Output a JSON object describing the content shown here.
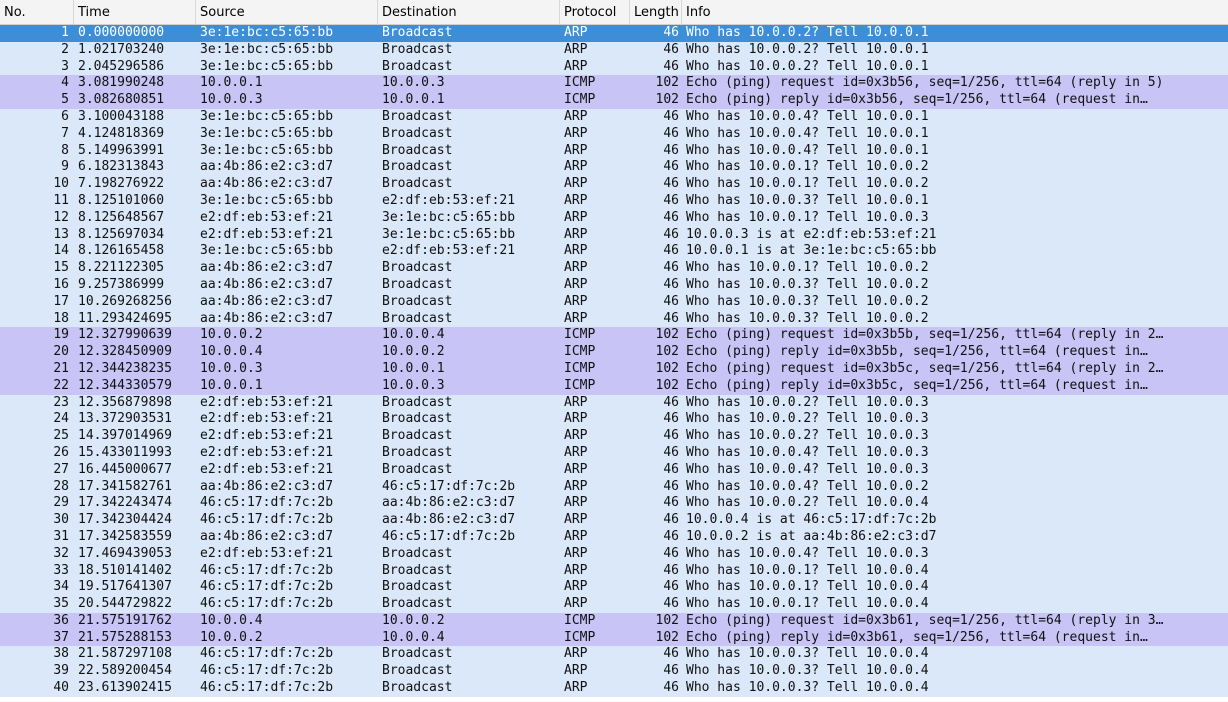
{
  "columns": {
    "no": "No.",
    "time": "Time",
    "source": "Source",
    "destination": "Destination",
    "protocol": "Protocol",
    "length": "Length",
    "info": "Info"
  },
  "colors": {
    "arp_row": "#dae8fa",
    "icmp_row": "#c8c4f6",
    "selected_row": "#3d8ed6"
  },
  "selected_row": 1,
  "packets": [
    {
      "no": "1",
      "time": "0.000000000",
      "src": "3e:1e:bc:c5:65:bb",
      "dst": "Broadcast",
      "proto": "ARP",
      "len": "46",
      "info": "Who has 10.0.0.2? Tell 10.0.0.1"
    },
    {
      "no": "2",
      "time": "1.021703240",
      "src": "3e:1e:bc:c5:65:bb",
      "dst": "Broadcast",
      "proto": "ARP",
      "len": "46",
      "info": "Who has 10.0.0.2? Tell 10.0.0.1"
    },
    {
      "no": "3",
      "time": "2.045296586",
      "src": "3e:1e:bc:c5:65:bb",
      "dst": "Broadcast",
      "proto": "ARP",
      "len": "46",
      "info": "Who has 10.0.0.2? Tell 10.0.0.1"
    },
    {
      "no": "4",
      "time": "3.081990248",
      "src": "10.0.0.1",
      "dst": "10.0.0.3",
      "proto": "ICMP",
      "len": "102",
      "info": "Echo (ping) request  id=0x3b56, seq=1/256, ttl=64 (reply in 5)"
    },
    {
      "no": "5",
      "time": "3.082680851",
      "src": "10.0.0.3",
      "dst": "10.0.0.1",
      "proto": "ICMP",
      "len": "102",
      "info": "Echo (ping) reply    id=0x3b56, seq=1/256, ttl=64 (request in…"
    },
    {
      "no": "6",
      "time": "3.100043188",
      "src": "3e:1e:bc:c5:65:bb",
      "dst": "Broadcast",
      "proto": "ARP",
      "len": "46",
      "info": "Who has 10.0.0.4? Tell 10.0.0.1"
    },
    {
      "no": "7",
      "time": "4.124818369",
      "src": "3e:1e:bc:c5:65:bb",
      "dst": "Broadcast",
      "proto": "ARP",
      "len": "46",
      "info": "Who has 10.0.0.4? Tell 10.0.0.1"
    },
    {
      "no": "8",
      "time": "5.149963991",
      "src": "3e:1e:bc:c5:65:bb",
      "dst": "Broadcast",
      "proto": "ARP",
      "len": "46",
      "info": "Who has 10.0.0.4? Tell 10.0.0.1"
    },
    {
      "no": "9",
      "time": "6.182313843",
      "src": "aa:4b:86:e2:c3:d7",
      "dst": "Broadcast",
      "proto": "ARP",
      "len": "46",
      "info": "Who has 10.0.0.1? Tell 10.0.0.2"
    },
    {
      "no": "10",
      "time": "7.198276922",
      "src": "aa:4b:86:e2:c3:d7",
      "dst": "Broadcast",
      "proto": "ARP",
      "len": "46",
      "info": "Who has 10.0.0.1? Tell 10.0.0.2"
    },
    {
      "no": "11",
      "time": "8.125101060",
      "src": "3e:1e:bc:c5:65:bb",
      "dst": "e2:df:eb:53:ef:21",
      "proto": "ARP",
      "len": "46",
      "info": "Who has 10.0.0.3? Tell 10.0.0.1"
    },
    {
      "no": "12",
      "time": "8.125648567",
      "src": "e2:df:eb:53:ef:21",
      "dst": "3e:1e:bc:c5:65:bb",
      "proto": "ARP",
      "len": "46",
      "info": "Who has 10.0.0.1? Tell 10.0.0.3"
    },
    {
      "no": "13",
      "time": "8.125697034",
      "src": "e2:df:eb:53:ef:21",
      "dst": "3e:1e:bc:c5:65:bb",
      "proto": "ARP",
      "len": "46",
      "info": "10.0.0.3 is at e2:df:eb:53:ef:21"
    },
    {
      "no": "14",
      "time": "8.126165458",
      "src": "3e:1e:bc:c5:65:bb",
      "dst": "e2:df:eb:53:ef:21",
      "proto": "ARP",
      "len": "46",
      "info": "10.0.0.1 is at 3e:1e:bc:c5:65:bb"
    },
    {
      "no": "15",
      "time": "8.221122305",
      "src": "aa:4b:86:e2:c3:d7",
      "dst": "Broadcast",
      "proto": "ARP",
      "len": "46",
      "info": "Who has 10.0.0.1? Tell 10.0.0.2"
    },
    {
      "no": "16",
      "time": "9.257386999",
      "src": "aa:4b:86:e2:c3:d7",
      "dst": "Broadcast",
      "proto": "ARP",
      "len": "46",
      "info": "Who has 10.0.0.3? Tell 10.0.0.2"
    },
    {
      "no": "17",
      "time": "10.269268256",
      "src": "aa:4b:86:e2:c3:d7",
      "dst": "Broadcast",
      "proto": "ARP",
      "len": "46",
      "info": "Who has 10.0.0.3? Tell 10.0.0.2"
    },
    {
      "no": "18",
      "time": "11.293424695",
      "src": "aa:4b:86:e2:c3:d7",
      "dst": "Broadcast",
      "proto": "ARP",
      "len": "46",
      "info": "Who has 10.0.0.3? Tell 10.0.0.2"
    },
    {
      "no": "19",
      "time": "12.327990639",
      "src": "10.0.0.2",
      "dst": "10.0.0.4",
      "proto": "ICMP",
      "len": "102",
      "info": "Echo (ping) request  id=0x3b5b, seq=1/256, ttl=64 (reply in 2…"
    },
    {
      "no": "20",
      "time": "12.328450909",
      "src": "10.0.0.4",
      "dst": "10.0.0.2",
      "proto": "ICMP",
      "len": "102",
      "info": "Echo (ping) reply    id=0x3b5b, seq=1/256, ttl=64 (request in…"
    },
    {
      "no": "21",
      "time": "12.344238235",
      "src": "10.0.0.3",
      "dst": "10.0.0.1",
      "proto": "ICMP",
      "len": "102",
      "info": "Echo (ping) request  id=0x3b5c, seq=1/256, ttl=64 (reply in 2…"
    },
    {
      "no": "22",
      "time": "12.344330579",
      "src": "10.0.0.1",
      "dst": "10.0.0.3",
      "proto": "ICMP",
      "len": "102",
      "info": "Echo (ping) reply    id=0x3b5c, seq=1/256, ttl=64 (request in…"
    },
    {
      "no": "23",
      "time": "12.356879898",
      "src": "e2:df:eb:53:ef:21",
      "dst": "Broadcast",
      "proto": "ARP",
      "len": "46",
      "info": "Who has 10.0.0.2? Tell 10.0.0.3"
    },
    {
      "no": "24",
      "time": "13.372903531",
      "src": "e2:df:eb:53:ef:21",
      "dst": "Broadcast",
      "proto": "ARP",
      "len": "46",
      "info": "Who has 10.0.0.2? Tell 10.0.0.3"
    },
    {
      "no": "25",
      "time": "14.397014969",
      "src": "e2:df:eb:53:ef:21",
      "dst": "Broadcast",
      "proto": "ARP",
      "len": "46",
      "info": "Who has 10.0.0.2? Tell 10.0.0.3"
    },
    {
      "no": "26",
      "time": "15.433011993",
      "src": "e2:df:eb:53:ef:21",
      "dst": "Broadcast",
      "proto": "ARP",
      "len": "46",
      "info": "Who has 10.0.0.4? Tell 10.0.0.3"
    },
    {
      "no": "27",
      "time": "16.445000677",
      "src": "e2:df:eb:53:ef:21",
      "dst": "Broadcast",
      "proto": "ARP",
      "len": "46",
      "info": "Who has 10.0.0.4? Tell 10.0.0.3"
    },
    {
      "no": "28",
      "time": "17.341582761",
      "src": "aa:4b:86:e2:c3:d7",
      "dst": "46:c5:17:df:7c:2b",
      "proto": "ARP",
      "len": "46",
      "info": "Who has 10.0.0.4? Tell 10.0.0.2"
    },
    {
      "no": "29",
      "time": "17.342243474",
      "src": "46:c5:17:df:7c:2b",
      "dst": "aa:4b:86:e2:c3:d7",
      "proto": "ARP",
      "len": "46",
      "info": "Who has 10.0.0.2? Tell 10.0.0.4"
    },
    {
      "no": "30",
      "time": "17.342304424",
      "src": "46:c5:17:df:7c:2b",
      "dst": "aa:4b:86:e2:c3:d7",
      "proto": "ARP",
      "len": "46",
      "info": "10.0.0.4 is at 46:c5:17:df:7c:2b"
    },
    {
      "no": "31",
      "time": "17.342583559",
      "src": "aa:4b:86:e2:c3:d7",
      "dst": "46:c5:17:df:7c:2b",
      "proto": "ARP",
      "len": "46",
      "info": "10.0.0.2 is at aa:4b:86:e2:c3:d7"
    },
    {
      "no": "32",
      "time": "17.469439053",
      "src": "e2:df:eb:53:ef:21",
      "dst": "Broadcast",
      "proto": "ARP",
      "len": "46",
      "info": "Who has 10.0.0.4? Tell 10.0.0.3"
    },
    {
      "no": "33",
      "time": "18.510141402",
      "src": "46:c5:17:df:7c:2b",
      "dst": "Broadcast",
      "proto": "ARP",
      "len": "46",
      "info": "Who has 10.0.0.1? Tell 10.0.0.4"
    },
    {
      "no": "34",
      "time": "19.517641307",
      "src": "46:c5:17:df:7c:2b",
      "dst": "Broadcast",
      "proto": "ARP",
      "len": "46",
      "info": "Who has 10.0.0.1? Tell 10.0.0.4"
    },
    {
      "no": "35",
      "time": "20.544729822",
      "src": "46:c5:17:df:7c:2b",
      "dst": "Broadcast",
      "proto": "ARP",
      "len": "46",
      "info": "Who has 10.0.0.1? Tell 10.0.0.4"
    },
    {
      "no": "36",
      "time": "21.575191762",
      "src": "10.0.0.4",
      "dst": "10.0.0.2",
      "proto": "ICMP",
      "len": "102",
      "info": "Echo (ping) request  id=0x3b61, seq=1/256, ttl=64 (reply in 3…"
    },
    {
      "no": "37",
      "time": "21.575288153",
      "src": "10.0.0.2",
      "dst": "10.0.0.4",
      "proto": "ICMP",
      "len": "102",
      "info": "Echo (ping) reply    id=0x3b61, seq=1/256, ttl=64 (request in…"
    },
    {
      "no": "38",
      "time": "21.587297108",
      "src": "46:c5:17:df:7c:2b",
      "dst": "Broadcast",
      "proto": "ARP",
      "len": "46",
      "info": "Who has 10.0.0.3? Tell 10.0.0.4"
    },
    {
      "no": "39",
      "time": "22.589200454",
      "src": "46:c5:17:df:7c:2b",
      "dst": "Broadcast",
      "proto": "ARP",
      "len": "46",
      "info": "Who has 10.0.0.3? Tell 10.0.0.4"
    },
    {
      "no": "40",
      "time": "23.613902415",
      "src": "46:c5:17:df:7c:2b",
      "dst": "Broadcast",
      "proto": "ARP",
      "len": "46",
      "info": "Who has 10.0.0.3? Tell 10.0.0.4"
    }
  ]
}
